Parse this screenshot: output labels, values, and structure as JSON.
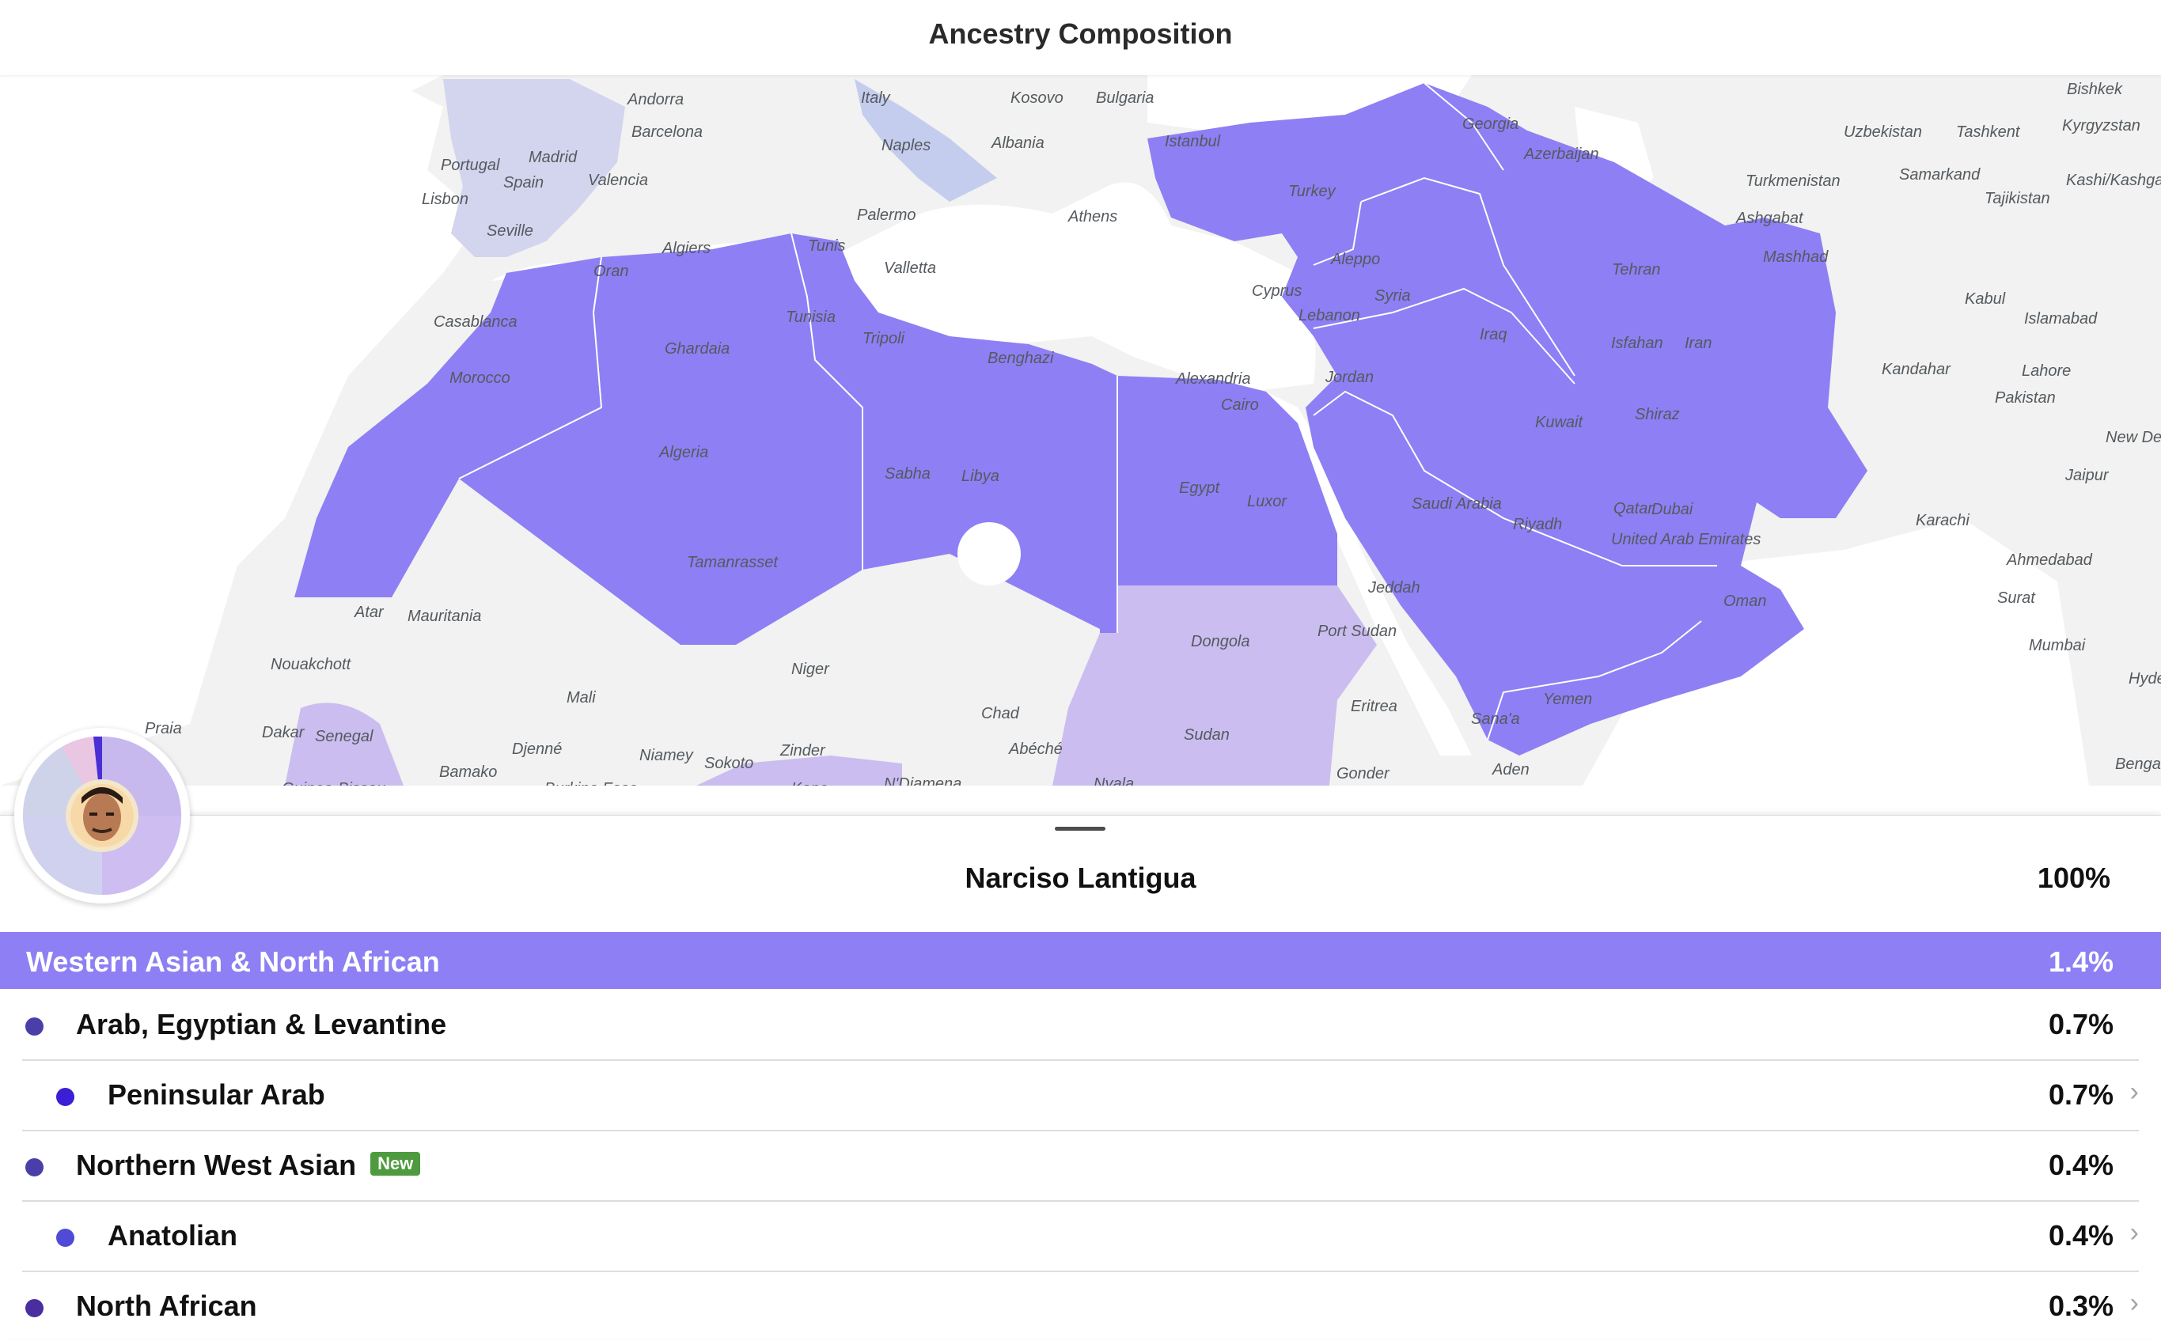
{
  "header": {
    "title": "Ancestry Composition"
  },
  "map": {
    "labels": [
      "Italy",
      "Kosovo",
      "Bulgaria",
      "Andorra",
      "Barcelona",
      "Madrid",
      "Portugal",
      "Spain",
      "Valencia",
      "Lisbon",
      "Seville",
      "Naples",
      "Albania",
      "Istanbul",
      "Georgia",
      "Azerbaijan",
      "Turkey",
      "Palermo",
      "Athens",
      "Algiers",
      "Tunis",
      "Oran",
      "Valletta",
      "Casablanca",
      "Tunisia",
      "Tripoli",
      "Ghardaia",
      "Benghazi",
      "Cyprus",
      "Aleppo",
      "Syria",
      "Lebanon",
      "Iraq",
      "Alexandria",
      "Cairo",
      "Jordan",
      "Morocco",
      "Algeria",
      "Sabha",
      "Libya",
      "Egypt",
      "Luxor",
      "Saudi Arabia",
      "Riyadh",
      "Qatar",
      "Dubai",
      "United Arab Emirates",
      "Kuwait",
      "Tamanrasset",
      "Oman",
      "Jeddah",
      "Port Sudan",
      "Dongola",
      "Sudan",
      "Eritrea",
      "Yemen",
      "Sana'a",
      "Aden",
      "Gonder",
      "Atar",
      "Mauritania",
      "Nouakchott",
      "Mali",
      "Niger",
      "Chad",
      "Praia",
      "Dakar",
      "Senegal",
      "Djenné",
      "Niamey",
      "Sokoto",
      "Zinder",
      "Abéché",
      "Bamako",
      "Tehran",
      "Mashhad",
      "Isfahan",
      "Iran",
      "Shiraz",
      "Ashgabat",
      "Turkmenistan",
      "Uzbekistan",
      "Tashkent",
      "Kyrgyzstan",
      "Bishkek",
      "Samarkand",
      "Tajikistan",
      "Kashi/Kashgar",
      "Kabul",
      "Islamabad",
      "Kandahar",
      "Lahore",
      "Pakistan",
      "New Delhi",
      "Jaipur",
      "Karachi",
      "Ahmedabad",
      "Surat",
      "Mumbai",
      "Hyderabad",
      "Bengaluru",
      "Guinea-Bissau",
      "Burkina Faso",
      "N'Djamena",
      "Nyala",
      "Kano"
    ]
  },
  "colors": {
    "primary": "#8e7ff4",
    "light": "#cbbdf0",
    "europe": "#d3d5ee"
  },
  "person": {
    "name": "Narciso Lantigua",
    "total": "100%"
  },
  "region": {
    "label": "Western Asian & North African",
    "pct": "1.4%"
  },
  "rows": [
    {
      "label": "Arab, Egyptian & Levantine",
      "pct": "0.7%",
      "color": "#4a3ea8"
    },
    {
      "label": "Peninsular Arab",
      "pct": "0.7%",
      "color": "#3a1fd6"
    },
    {
      "label": "Northern West Asian",
      "pct": "0.4%",
      "badge": "New",
      "color": "#4a3ea8"
    },
    {
      "label": "Anatolian",
      "pct": "0.4%",
      "color": "#4f4bd6"
    },
    {
      "label": "North African",
      "pct": "0.3%",
      "color": "#4a2ea0"
    }
  ],
  "icons": [
    "info-icon",
    "chevron-right-icon",
    "avatar-icon",
    "ancestry-donut-icon"
  ]
}
